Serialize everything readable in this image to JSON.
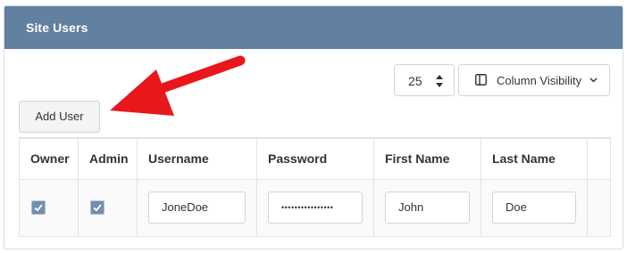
{
  "panel": {
    "title": "Site Users"
  },
  "toolbar": {
    "page_size": "25",
    "column_visibility_label": "Column Visibility",
    "add_user_label": "Add User"
  },
  "table": {
    "headers": [
      "Owner",
      "Admin",
      "Username",
      "Password",
      "First Name",
      "Last Name"
    ],
    "rows": [
      {
        "owner_checked": true,
        "admin_checked": true,
        "username": "JoneDoe",
        "password": "••••••••••••••••",
        "first_name": "John",
        "last_name": "Doe"
      }
    ]
  },
  "colors": {
    "header_bg": "#62809f",
    "checkbox_fill": "#6f8fb3",
    "arrow": "#e8171b"
  },
  "icons": {
    "page_size_stepper": "up-down-arrows-icon",
    "column_visibility": "columns-icon",
    "dropdown": "chevron-down-icon",
    "annotation": "red-arrow-icon",
    "checkbox": "checkmark-icon"
  }
}
